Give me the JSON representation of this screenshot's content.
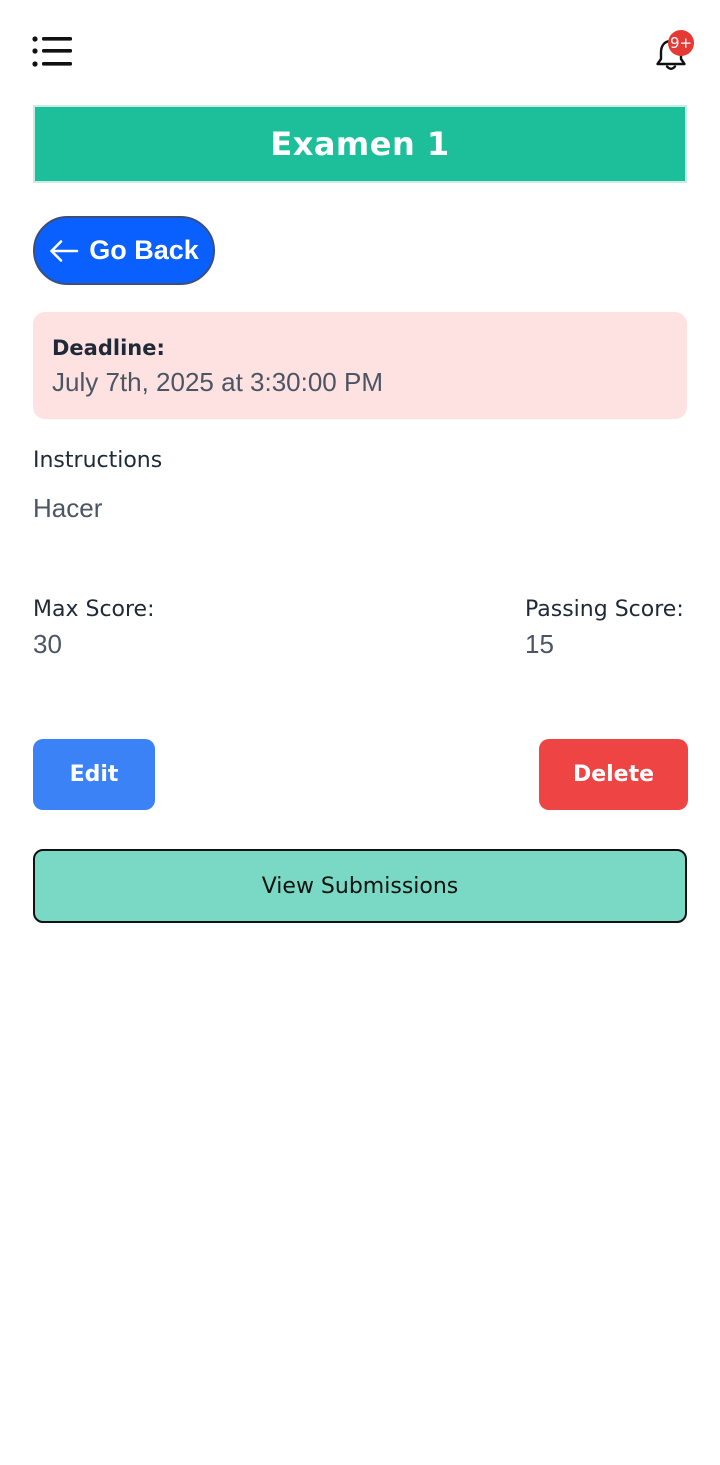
{
  "header": {
    "menu_icon": "menu-list-icon",
    "bell_icon": "bell-icon",
    "notification_badge": "9+"
  },
  "assignment": {
    "title": "Examen 1"
  },
  "navigation": {
    "go_back_label": "Go Back",
    "go_back_icon": "arrow-left-icon"
  },
  "deadline": {
    "label": "Deadline:",
    "value": "July 7th, 2025 at 3:30:00 PM"
  },
  "instructions": {
    "label": "Instructions",
    "text": "Hacer"
  },
  "scores": {
    "max_label": "Max Score:",
    "max_value": "30",
    "passing_label": "Passing Score:",
    "passing_value": "15"
  },
  "actions": {
    "edit_label": "Edit",
    "delete_label": "Delete",
    "view_submissions_label": "View Submissions"
  },
  "colors": {
    "banner": "#1dbf9b",
    "go_back": "#0a5fff",
    "deadline_bg": "#fde2e1",
    "edit": "#3b82f6",
    "delete": "#ef4444",
    "view_submissions": "#79d9c4",
    "badge": "#e53935"
  }
}
